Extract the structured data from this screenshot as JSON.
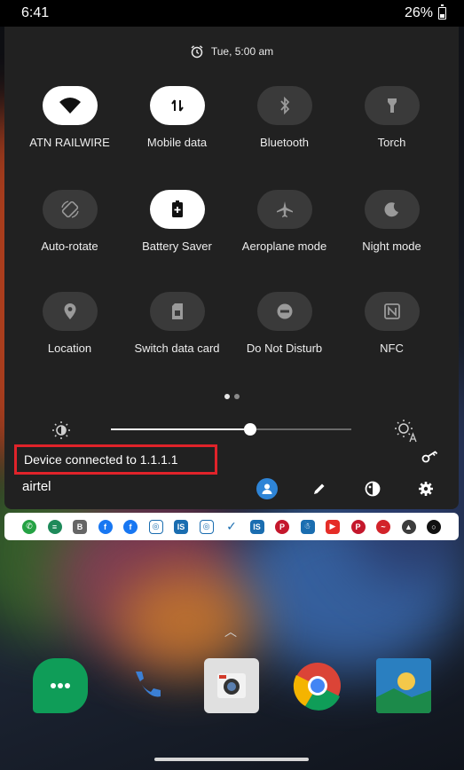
{
  "status_bar": {
    "time": "6:41",
    "battery": "26%"
  },
  "alarm": {
    "text": "Tue, 5:00 am"
  },
  "tiles": [
    {
      "label": "ATN RAILWIRE",
      "icon": "wifi-icon",
      "on": true
    },
    {
      "label": "Mobile data",
      "icon": "data-arrows-icon",
      "on": true
    },
    {
      "label": "Bluetooth",
      "icon": "bluetooth-icon",
      "on": false
    },
    {
      "label": "Torch",
      "icon": "flashlight-icon",
      "on": false
    },
    {
      "label": "Auto-rotate",
      "icon": "rotate-icon",
      "on": false
    },
    {
      "label": "Battery Saver",
      "icon": "battery-plus-icon",
      "on": true
    },
    {
      "label": "Aeroplane mode",
      "icon": "airplane-icon",
      "on": false
    },
    {
      "label": "Night mode",
      "icon": "moon-icon",
      "on": false
    },
    {
      "label": "Location",
      "icon": "location-pin-icon",
      "on": false
    },
    {
      "label": "Switch data card",
      "icon": "sim-card-icon",
      "on": false
    },
    {
      "label": "Do Not Disturb",
      "icon": "dnd-icon",
      "on": false
    },
    {
      "label": "NFC",
      "icon": "nfc-icon",
      "on": false
    }
  ],
  "pagination": {
    "current_page": 1,
    "total_pages": 2
  },
  "brightness": {
    "level": 0.58
  },
  "vpn": {
    "text": "Device connected to 1.1.1.1"
  },
  "carrier": {
    "name": "airtel"
  },
  "footer_icons": [
    "user-icon",
    "edit-icon",
    "theme-icon",
    "settings-icon"
  ],
  "colors": {
    "highlight_border": "#e0232a",
    "panel": "#212121",
    "user_accent": "#2e84d6"
  },
  "notification_apps": [
    "whatsapp-icon",
    "messaging-icon",
    "app-b-icon",
    "facebook-icon",
    "facebook-icon",
    "instagram-icon",
    "is-icon",
    "instagram-icon",
    "check-icon",
    "is-icon",
    "pinterest-icon",
    "snapchat-icon",
    "youtube-icon",
    "pinterest-icon",
    "airtel-icon",
    "aura-icon",
    "circle-icon"
  ],
  "dock_apps": [
    "hangouts-icon",
    "phone-icon",
    "camera-icon",
    "chrome-icon",
    "gallery-icon"
  ]
}
